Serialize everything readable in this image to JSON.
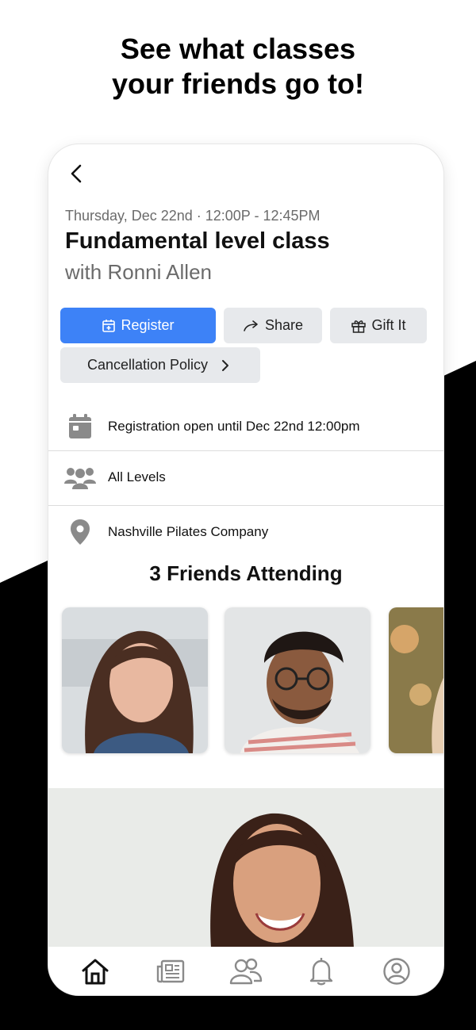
{
  "headline": {
    "line1": "See what classes",
    "line2": "your friends go to!"
  },
  "class": {
    "datetime": "Thursday, Dec 22nd · 12:00P - 12:45PM",
    "title": "Fundamental level class",
    "instructor": "with Ronni Allen"
  },
  "actions": {
    "register": "Register",
    "share": "Share",
    "gift": "Gift It",
    "policy": "Cancellation Policy"
  },
  "info": {
    "registration": "Registration open until Dec 22nd 12:00pm",
    "level": "All Levels",
    "location": "Nashville Pilates Company"
  },
  "friends": {
    "heading": "3 Friends Attending"
  },
  "tabs": [
    "home-icon",
    "news-icon",
    "friends-icon",
    "bell-icon",
    "profile-icon"
  ],
  "colors": {
    "primary": "#3d82f7",
    "button_gray": "#e7e9ec",
    "icon_gray": "#8a8a8a"
  }
}
